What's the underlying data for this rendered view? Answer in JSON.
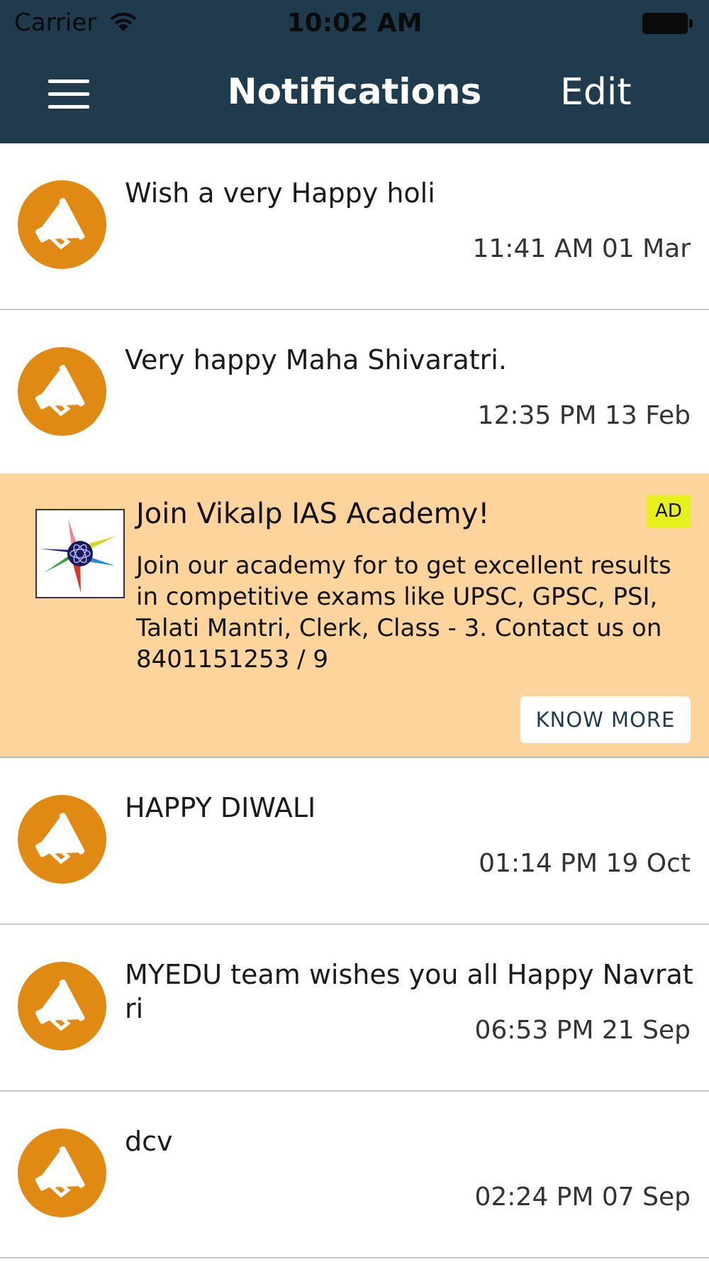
{
  "status_bar": {
    "carrier": "Carrier",
    "time": "10:02 AM"
  },
  "nav": {
    "title": "Notifications",
    "edit_label": "Edit",
    "menu_icon": "hamburger-menu-icon"
  },
  "notifications": [
    {
      "text": "Wish a very Happy holi",
      "time": "11:41 AM 01 Mar"
    },
    {
      "text": "Very happy Maha Shivaratri.",
      "time": "12:35 PM 13 Feb"
    },
    {
      "text": "HAPPY DIWALI",
      "time": "01:14 PM 19 Oct"
    },
    {
      "text": "MYEDU team wishes you all Happy Navratri",
      "time": "06:53 PM 21 Sep"
    },
    {
      "text": "dcv",
      "time": "02:24 PM 07 Sep"
    }
  ],
  "ad": {
    "title": "Join Vikalp IAS Academy!",
    "badge": "AD",
    "body": "Join our academy for to get excellent results in competitive exams like UPSC, GPSC, PSI, Talati Mantri, Clerk, Class - 3. Contact us on 8401151253 / 9",
    "cta_label": "KNOW MORE"
  },
  "colors": {
    "nav_background": "#1f3b4d",
    "avatar": "#e08a13",
    "ad_background": "#fcd49c",
    "ad_badge": "#e6f01a"
  },
  "icons": {
    "avatar": "megaphone-icon",
    "wifi": "wifi-icon",
    "battery": "battery-icon"
  }
}
